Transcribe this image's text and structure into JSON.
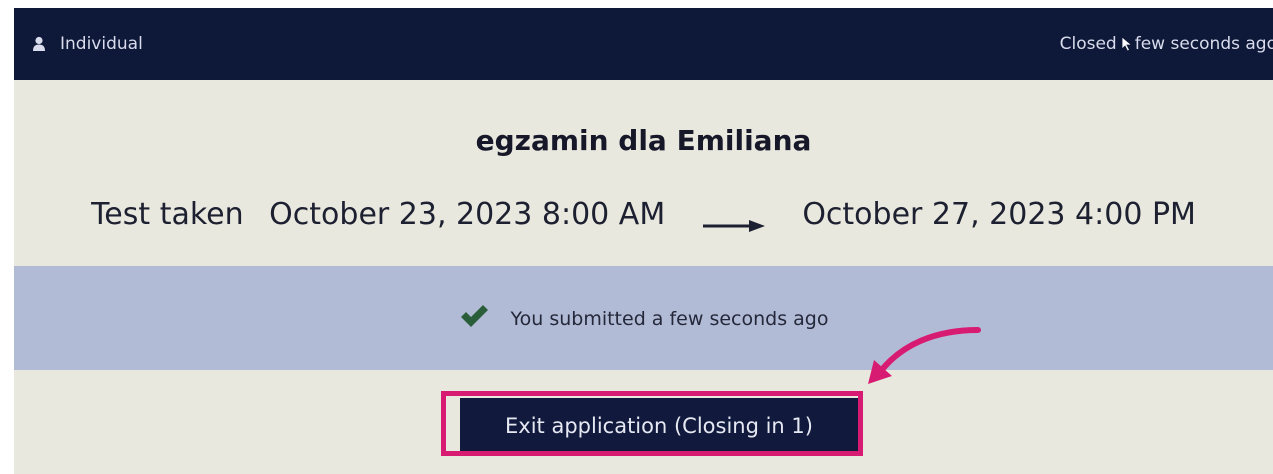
{
  "topbar": {
    "left_label": "Individual",
    "right_prefix": "Closed",
    "right_suffix": "few seconds ago"
  },
  "exam": {
    "title": "egzamin dla Emiliana",
    "taken_label": "Test taken",
    "start": "October 23, 2023 8:00 AM",
    "end": "October 27, 2023 4:00 PM"
  },
  "status": {
    "message": "You submitted a few seconds ago"
  },
  "actions": {
    "exit_label": "Exit application (Closing in 1)"
  },
  "colors": {
    "topbar": "#0e1838",
    "band": "#b2bbd6",
    "check": "#2a5e3a",
    "button": "#111a3d",
    "highlight": "#d81b72"
  },
  "icons": {
    "user": "user-icon",
    "cursor": "cursor-icon",
    "check": "check-icon",
    "arrow": "arrow-right-icon",
    "annotation": "curved-arrow-icon"
  }
}
